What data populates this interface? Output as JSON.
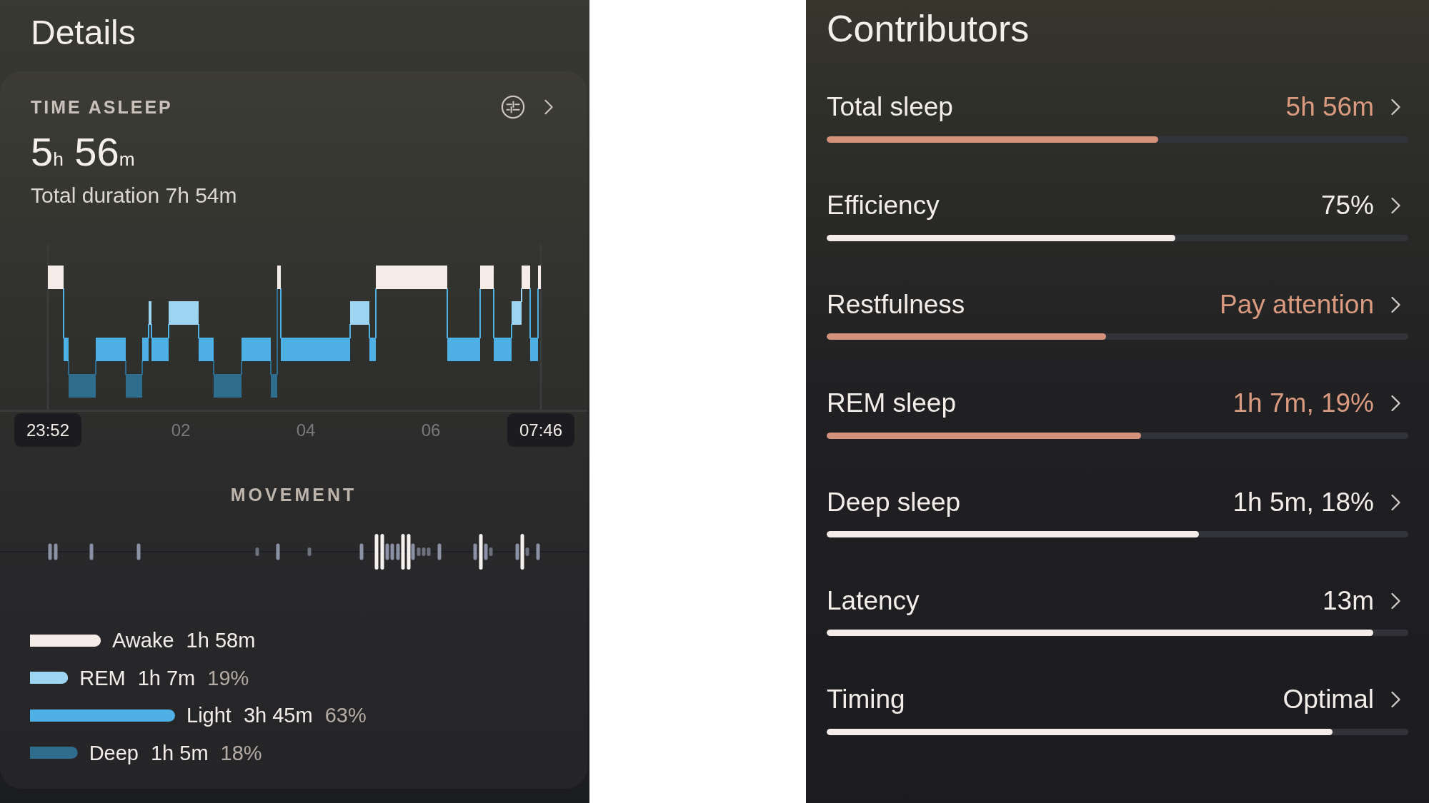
{
  "details": {
    "title": "Details"
  },
  "time_asleep": {
    "label": "TIME ASLEEP",
    "value": "5$_{h}$ 56$_{m}$",
    "total_duration": "Total duration 7h 54m"
  },
  "hypnogram": {
    "time_labels": [
      {
        "text": "23:52",
        "kind": "endpoint"
      },
      {
        "text": "02",
        "kind": "tick"
      },
      {
        "text": "04",
        "kind": "tick"
      },
      {
        "text": "06",
        "kind": "tick"
      },
      {
        "text": "07:46",
        "kind": "endpoint"
      }
    ]
  },
  "movement": {
    "title": "MOVEMENT"
  },
  "legend": [
    {
      "label": "Awake",
      "duration": "1h 58m",
      "color": "#f5ebe7"
    },
    {
      "label": "REM",
      "duration": "1h 7m",
      "percent": "19%",
      "color": "#9dd4f2"
    },
    {
      "label": "Light",
      "duration": "3h 45m",
      "percent": "63%",
      "color": "#4fb0e6"
    },
    {
      "label": "Deep",
      "duration": "1h 5m",
      "percent": "18%",
      "color": "#2f6d8e"
    }
  ],
  "contributors": {
    "title": "Contributors",
    "items": [
      {
        "label": "Total sleep",
        "value": "5h 56m",
        "attention": true,
        "level": 0.57
      },
      {
        "label": "Efficiency",
        "value": "75%",
        "attention": false,
        "level": 0.6
      },
      {
        "label": "Restfulness",
        "value": "Pay attention",
        "attention": true,
        "level": 0.48
      },
      {
        "label": "REM sleep",
        "value": "1h 7m, 19%",
        "attention": true,
        "level": 0.54
      },
      {
        "label": "Deep sleep",
        "value": "1h 5m, 18%",
        "attention": false,
        "level": 0.64
      },
      {
        "label": "Latency",
        "value": "13m",
        "attention": false,
        "level": 0.94
      },
      {
        "label": "Timing",
        "value": "Optimal",
        "attention": false,
        "level": 0.87
      }
    ]
  }
}
